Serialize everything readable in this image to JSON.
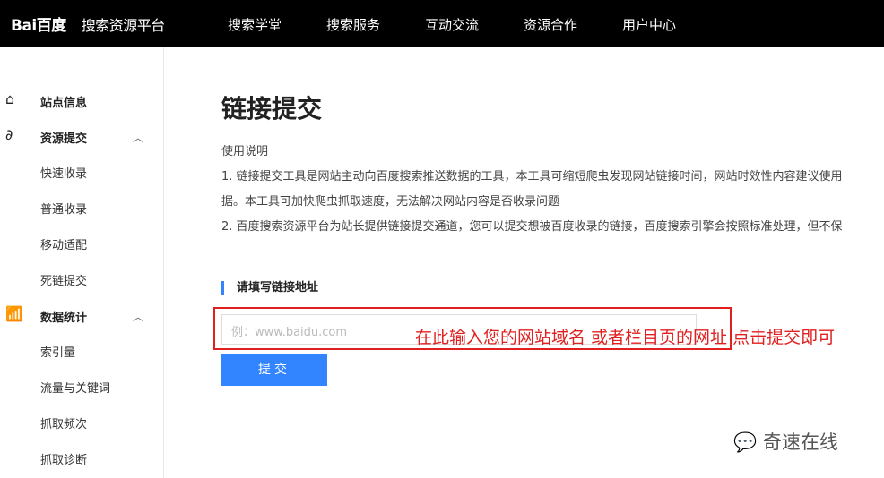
{
  "header": {
    "logo": "Bai百度",
    "platform": "搜索资源平台",
    "nav": [
      "搜索学堂",
      "搜索服务",
      "互动交流",
      "资源合作",
      "用户中心"
    ]
  },
  "sidebar": {
    "items": [
      {
        "label": "站点信息",
        "bold": true,
        "icon": "home-icon"
      },
      {
        "label": "资源提交",
        "bold": true,
        "icon": "link-icon"
      },
      {
        "label": "快速收录"
      },
      {
        "label": "普通收录"
      },
      {
        "label": "移动适配"
      },
      {
        "label": "死链提交"
      },
      {
        "label": "数据统计",
        "bold": true,
        "icon": "chart-icon"
      },
      {
        "label": "索引量"
      },
      {
        "label": "流量与关键词"
      },
      {
        "label": "抓取频次"
      },
      {
        "label": "抓取诊断"
      }
    ]
  },
  "main": {
    "title": "链接提交",
    "usage_title": "使用说明",
    "lines": [
      "1. 链接提交工具是网站主动向百度搜索推送数据的工具，本工具可缩短爬虫发现网站链接时间，网站时效性内容建议使用",
      "据。本工具可加快爬虫抓取速度，无法解决网站内容是否收录问题",
      "2. 百度搜索资源平台为站长提供链接提交通道，您可以提交想被百度收录的链接，百度搜索引擎会按照标准处理，但不保"
    ],
    "input_label": "请填写链接地址",
    "input_placeholder": "例：www.baidu.com",
    "submit": "提交",
    "annotation": "在此输入您的网站域名 或者栏目页的网址 点击提交即可"
  },
  "watermark": "奇速在线"
}
